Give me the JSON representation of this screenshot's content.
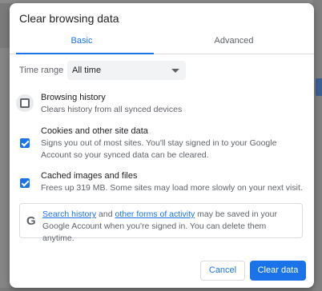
{
  "dialog": {
    "title": "Clear browsing data"
  },
  "tabs": [
    {
      "label": "Basic",
      "active": true
    },
    {
      "label": "Advanced",
      "active": false
    }
  ],
  "time_range": {
    "label": "Time range",
    "value": "All time"
  },
  "options": [
    {
      "title": "Browsing history",
      "description": "Clears history from all synced devices",
      "checked": false
    },
    {
      "title": "Cookies and other site data",
      "description": "Signs you out of most sites. You'll stay signed in to your Google Account so your synced data can be cleared.",
      "checked": true
    },
    {
      "title": "Cached images and files",
      "description": "Frees up 319 MB. Some sites may load more slowly on your next visit.",
      "checked": true
    }
  ],
  "info": {
    "icon": "G",
    "link1": "Search history",
    "text1": " and ",
    "link2": "other forms of activity",
    "text2": " may be saved in your Google Account when you're signed in. You can delete them anytime."
  },
  "buttons": {
    "cancel": "Cancel",
    "clear": "Clear data"
  },
  "colors": {
    "accent": "#1a73e8",
    "text": "#202124",
    "secondary_text": "#5f6368"
  }
}
